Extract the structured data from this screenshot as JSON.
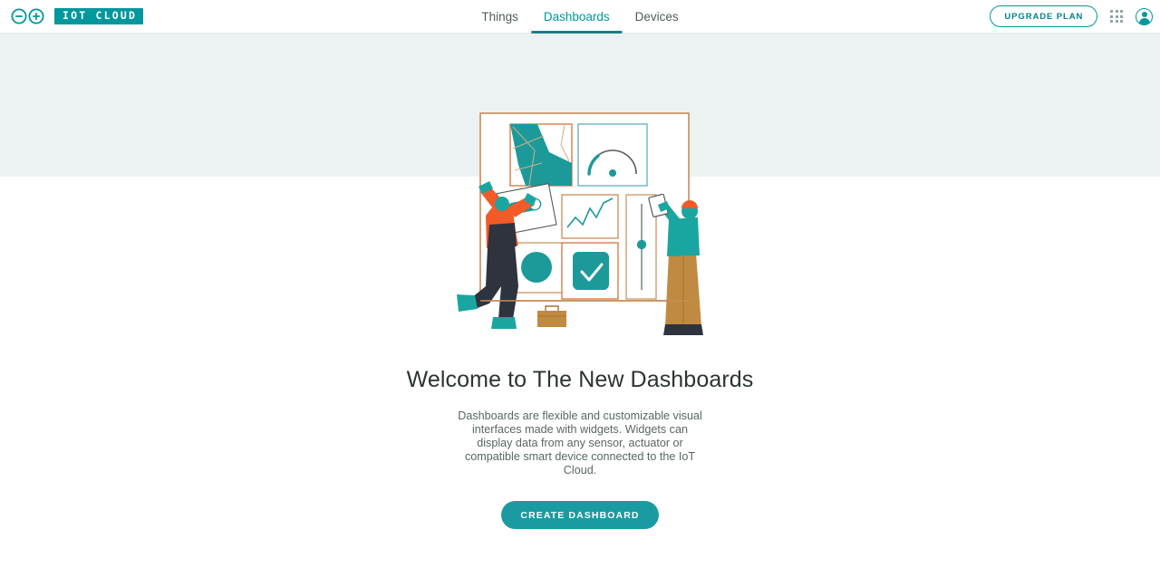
{
  "header": {
    "brand": {
      "logo_icon": "arduino-infinity-icon",
      "badge_label": "IOT CLOUD"
    },
    "nav": [
      {
        "label": "Things",
        "active": false
      },
      {
        "label": "Dashboards",
        "active": true
      },
      {
        "label": "Devices",
        "active": false
      }
    ],
    "upgrade_label": "UPGRADE PLAN",
    "apps_icon": "apps-grid-icon",
    "avatar_icon": "user-avatar-icon"
  },
  "main": {
    "illustration_name": "dashboards-empty-state-illustration",
    "title": "Welcome to The New Dashboards",
    "description": "Dashboards are flexible and customizable visual interfaces made with widgets. Widgets can display data from any sensor, actuator or compatible smart device connected to the IoT Cloud.",
    "cta_label": "CREATE DASHBOARD"
  },
  "colors": {
    "teal": "#00979d",
    "teal_dark": "#1a7f82",
    "cta_teal": "#1a9ba1",
    "band_gray": "#ecf1f1",
    "orange": "#f25a27",
    "navy": "#2f333d",
    "tan": "#c08a42",
    "frame_border": "#c98b55"
  }
}
